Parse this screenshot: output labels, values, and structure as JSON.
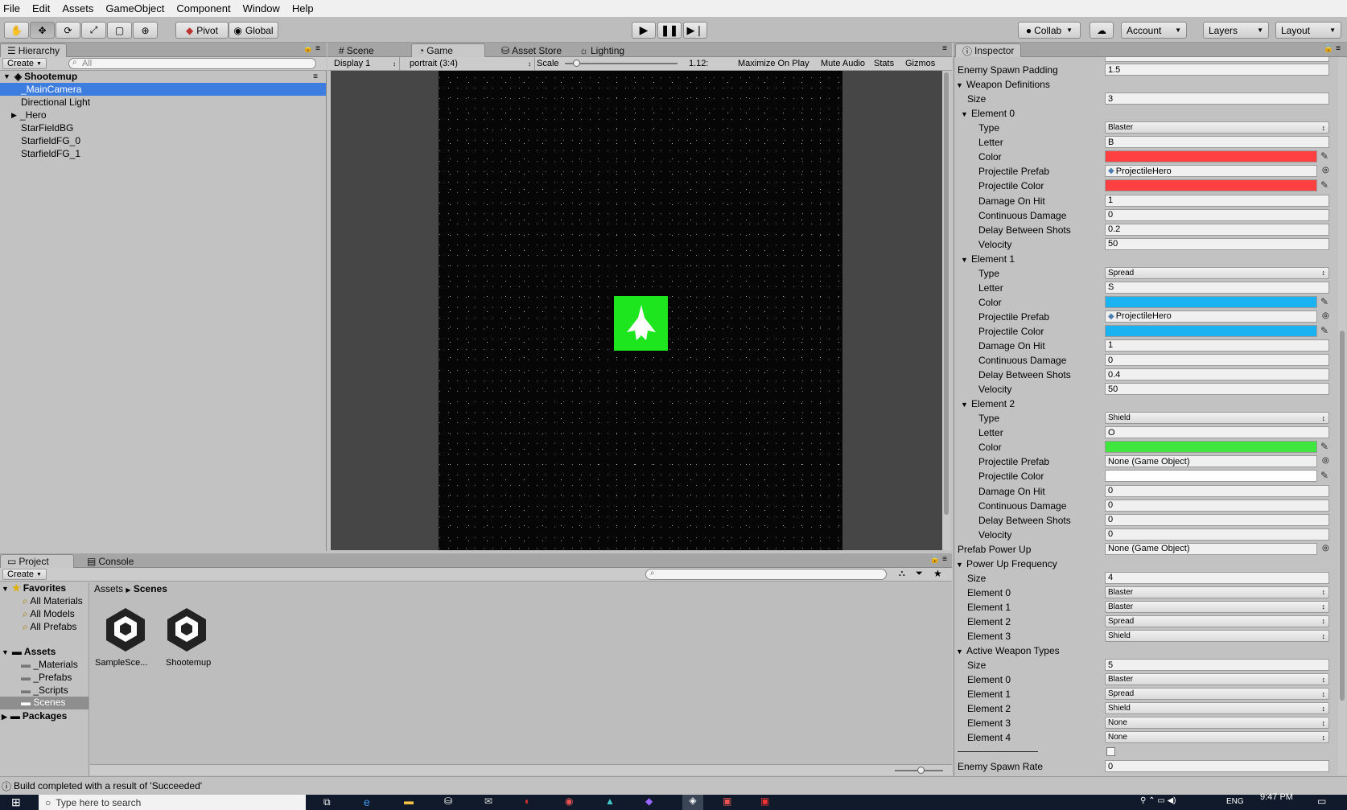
{
  "menu": [
    "File",
    "Edit",
    "Assets",
    "GameObject",
    "Component",
    "Window",
    "Help"
  ],
  "toolbar": {
    "pivot": "Pivot",
    "global": "Global",
    "collab": "Collab",
    "account": "Account",
    "layers": "Layers",
    "layout": "Layout"
  },
  "hierarchy": {
    "tab": "Hierarchy",
    "create": "Create",
    "search_placeholder": "All",
    "scene": "Shootemup",
    "items": [
      "_MainCamera",
      "Directional Light",
      "_Hero",
      "StarFieldBG",
      "StarfieldFG_0",
      "StarfieldFG_1"
    ]
  },
  "game": {
    "tabs": [
      "Scene",
      "Game",
      "Asset Store",
      "Lighting"
    ],
    "display": "Display 1",
    "aspect": "portrait (3:4)",
    "scale_label": "Scale",
    "scale_value": "1.12:",
    "maximize": "Maximize On Play",
    "mute": "Mute Audio",
    "stats": "Stats",
    "gizmos": "Gizmos"
  },
  "inspector": {
    "tab": "Inspector",
    "rows": [
      {
        "label": "Enemy Spawn Padding",
        "indent": 0,
        "value": "1.5",
        "kind": "text"
      },
      {
        "label": "Weapon Definitions",
        "indent": 0,
        "fold": true
      },
      {
        "label": "Size",
        "indent": 1,
        "value": "3",
        "kind": "text"
      },
      {
        "label": "Element 0",
        "indent": 1,
        "fold": true
      },
      {
        "label": "Type",
        "indent": 2,
        "value": "Blaster",
        "kind": "select"
      },
      {
        "label": "Letter",
        "indent": 2,
        "value": "B",
        "kind": "text"
      },
      {
        "label": "Color",
        "indent": 2,
        "value": "#ff4040",
        "kind": "color"
      },
      {
        "label": "Projectile Prefab",
        "indent": 2,
        "value": "ProjectileHero",
        "kind": "obj"
      },
      {
        "label": "Projectile Color",
        "indent": 2,
        "value": "#ff4040",
        "kind": "color"
      },
      {
        "label": "Damage On Hit",
        "indent": 2,
        "value": "1",
        "kind": "text"
      },
      {
        "label": "Continuous Damage",
        "indent": 2,
        "value": "0",
        "kind": "text"
      },
      {
        "label": "Delay Between Shots",
        "indent": 2,
        "value": "0.2",
        "kind": "text"
      },
      {
        "label": "Velocity",
        "indent": 2,
        "value": "50",
        "kind": "text"
      },
      {
        "label": "Element 1",
        "indent": 1,
        "fold": true
      },
      {
        "label": "Type",
        "indent": 2,
        "value": "Spread",
        "kind": "select"
      },
      {
        "label": "Letter",
        "indent": 2,
        "value": "S",
        "kind": "text"
      },
      {
        "label": "Color",
        "indent": 2,
        "value": "#1ab2f0",
        "kind": "color"
      },
      {
        "label": "Projectile Prefab",
        "indent": 2,
        "value": "ProjectileHero",
        "kind": "obj"
      },
      {
        "label": "Projectile Color",
        "indent": 2,
        "value": "#1ab2f0",
        "kind": "color"
      },
      {
        "label": "Damage On Hit",
        "indent": 2,
        "value": "1",
        "kind": "text"
      },
      {
        "label": "Continuous Damage",
        "indent": 2,
        "value": "0",
        "kind": "text"
      },
      {
        "label": "Delay Between Shots",
        "indent": 2,
        "value": "0.4",
        "kind": "text"
      },
      {
        "label": "Velocity",
        "indent": 2,
        "value": "50",
        "kind": "text"
      },
      {
        "label": "Element 2",
        "indent": 1,
        "fold": true
      },
      {
        "label": "Type",
        "indent": 2,
        "value": "Shield",
        "kind": "select"
      },
      {
        "label": "Letter",
        "indent": 2,
        "value": "O",
        "kind": "text"
      },
      {
        "label": "Color",
        "indent": 2,
        "value": "#3ee63e",
        "kind": "color"
      },
      {
        "label": "Projectile Prefab",
        "indent": 2,
        "value": "None (Game Object)",
        "kind": "obj"
      },
      {
        "label": "Projectile Color",
        "indent": 2,
        "value": "#ffffff",
        "kind": "color"
      },
      {
        "label": "Damage On Hit",
        "indent": 2,
        "value": "0",
        "kind": "text"
      },
      {
        "label": "Continuous Damage",
        "indent": 2,
        "value": "0",
        "kind": "text"
      },
      {
        "label": "Delay Between Shots",
        "indent": 2,
        "value": "0",
        "kind": "text"
      },
      {
        "label": "Velocity",
        "indent": 2,
        "value": "0",
        "kind": "text"
      },
      {
        "label": "Prefab Power Up",
        "indent": 0,
        "value": "None (Game Object)",
        "kind": "obj"
      },
      {
        "label": "Power Up Frequency",
        "indent": 0,
        "fold": true
      },
      {
        "label": "Size",
        "indent": 1,
        "value": "4",
        "kind": "text"
      },
      {
        "label": "Element 0",
        "indent": 1,
        "value": "Blaster",
        "kind": "select"
      },
      {
        "label": "Element 1",
        "indent": 1,
        "value": "Blaster",
        "kind": "select"
      },
      {
        "label": "Element 2",
        "indent": 1,
        "value": "Spread",
        "kind": "select"
      },
      {
        "label": "Element 3",
        "indent": 1,
        "value": "Shield",
        "kind": "select"
      },
      {
        "label": "Active Weapon Types",
        "indent": 0,
        "fold": true
      },
      {
        "label": "Size",
        "indent": 1,
        "value": "5",
        "kind": "text"
      },
      {
        "label": "Element 0",
        "indent": 1,
        "value": "Blaster",
        "kind": "select"
      },
      {
        "label": "Element 1",
        "indent": 1,
        "value": "Spread",
        "kind": "select"
      },
      {
        "label": "Element 2",
        "indent": 1,
        "value": "Shield",
        "kind": "select"
      },
      {
        "label": "Element 3",
        "indent": 1,
        "value": "None",
        "kind": "select"
      },
      {
        "label": "Element 4",
        "indent": 1,
        "value": "None",
        "kind": "select"
      },
      {
        "label": "",
        "indent": 0,
        "kind": "check"
      },
      {
        "label": "Enemy Spawn Rate",
        "indent": 0,
        "value": "0",
        "kind": "text"
      }
    ]
  },
  "project": {
    "tabs": [
      "Project",
      "Console"
    ],
    "create": "Create",
    "favorites": "Favorites",
    "fav_items": [
      "All Materials",
      "All Models",
      "All Prefabs"
    ],
    "assets": "Assets",
    "asset_folders": [
      "_Materials",
      "_Prefabs",
      "_Scripts",
      "Scenes"
    ],
    "packages": "Packages",
    "breadcrumb": [
      "Assets",
      "Scenes"
    ],
    "files": [
      "SampleSce...",
      "Shootemup"
    ]
  },
  "status": "Build completed with a result of 'Succeeded'",
  "taskbar": {
    "search": "Type here to search",
    "lang": "ENG",
    "time": "9:47 PM"
  }
}
